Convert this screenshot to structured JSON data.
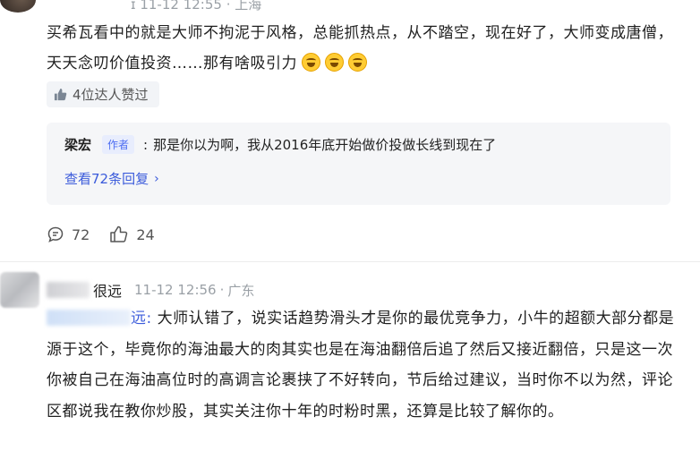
{
  "comment1": {
    "meta_text": "ɪ  11-12 12:55 · 上海",
    "text": "买希瓦看中的就是大师不拘泥于风格，总能抓热点，从不踏空，现在好了，大师变成唐僧，天天念叨价值投资……那有啥吸引力",
    "emojis": [
      "laugh-cry-emoji",
      "laugh-cry-emoji",
      "laugh-cry-emoji"
    ],
    "liked_label": "4位达人赞过",
    "reply": {
      "user": "梁宏",
      "tag": "作者",
      "separator": ":",
      "text": "那是你以为啊，我从2016年底开始做价投做长线到现在了"
    },
    "view_replies_label": "查看72条回复",
    "comment_count": "72",
    "like_count": "24"
  },
  "comment2": {
    "user_suffix": "很远",
    "time": "11-12 12:56",
    "location": "广东",
    "separator": "·",
    "mention_suffix": "远:",
    "text": "大师认错了，说实话趋势滑头才是你的最优竞争力，小牛的超额大部分都是源于这个，毕竟你的海油最大的肉其实也是在海油翻倍后追了然后又接近翻倍，只是这一次你被自己在海油高位时的高调言论裹挟了不好转向，节后给过建议，当时你不以为然，评论区都说我在教你炒股，其实关注你十年的时粉时黑，还算是比较了解你的。"
  },
  "colors": {
    "link": "#3b5bdb",
    "meta": "#9aa0a6",
    "reply_bg": "#f5f6f8"
  }
}
